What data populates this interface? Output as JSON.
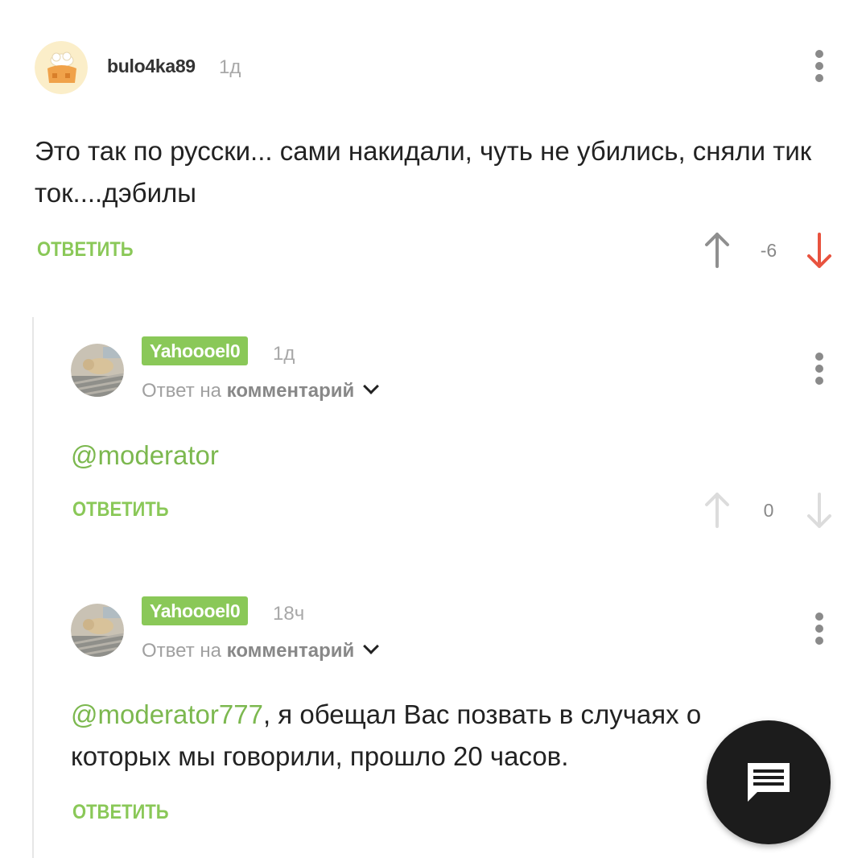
{
  "comments": [
    {
      "username": "bulo4ka89",
      "time": "1д",
      "text": "Это так по русски... сами накидали, чуть не убились, сняли тик ток....дэбилы",
      "reply_label": "ОТВЕТИТЬ",
      "score": "-6",
      "vote_state": "down"
    },
    {
      "username": "Yahoooel0",
      "time": "1д",
      "reply_to_prefix": "Ответ на",
      "reply_to_target": "комментарий",
      "mention": "@moderator",
      "text": "",
      "reply_label": "ОТВЕТИТЬ",
      "score": "0",
      "vote_state": "none"
    },
    {
      "username": "Yahoooel0",
      "time": "18ч",
      "reply_to_prefix": "Ответ на",
      "reply_to_target": "комментарий",
      "mention": "@moderator777",
      "text": ", я обещал Вас позвать в случаях о которых мы говорили, прошло 20 часов.",
      "reply_label": "ОТВЕТИТЬ",
      "score": "",
      "vote_state": "none"
    }
  ],
  "icons": {
    "menu": "more-vertical-icon",
    "upvote": "arrow-up-icon",
    "downvote": "arrow-down-icon",
    "fab": "comment-icon",
    "reply_chevron": "chevron-down-icon"
  },
  "colors": {
    "accent_green": "#8ac858",
    "downvote_red": "#e8533f",
    "fab_bg": "#1c1c1c"
  }
}
